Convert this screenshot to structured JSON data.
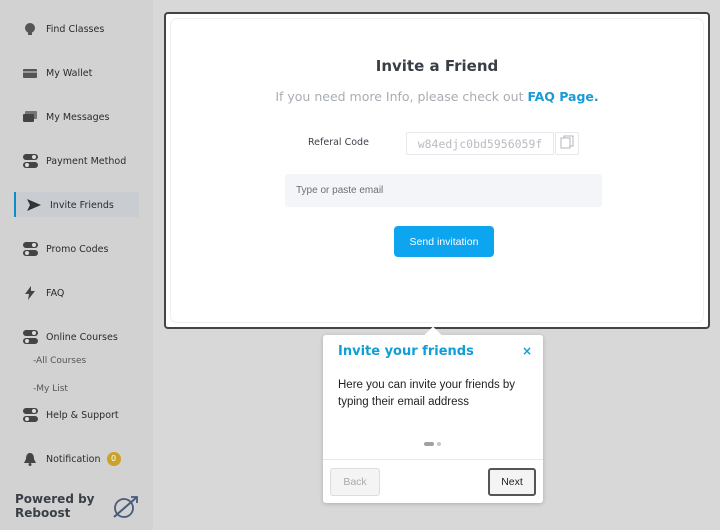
{
  "sidebar": {
    "items": [
      {
        "label": "Find Classes",
        "icon": "graduation-icon"
      },
      {
        "label": "My Wallet",
        "icon": "wallet-icon"
      },
      {
        "label": "My Messages",
        "icon": "messages-icon"
      },
      {
        "label": "Payment Method",
        "icon": "toggle-icon"
      },
      {
        "label": "Invite Friends",
        "icon": "send-icon"
      },
      {
        "label": "Promo Codes",
        "icon": "toggle-icon"
      },
      {
        "label": "FAQ",
        "icon": "bolt-icon"
      },
      {
        "label": "Online Courses",
        "icon": "toggle-icon"
      },
      {
        "label": "Help & Support",
        "icon": "toggle-icon"
      },
      {
        "label": "Notification",
        "icon": "bell-icon"
      }
    ],
    "sub_items": [
      "-All Courses",
      "-My List"
    ],
    "notification_count": "0",
    "powered_line1": "Powered by",
    "powered_line2": "Reboost",
    "accent_color": "#0b8ec5"
  },
  "modal": {
    "title": "Invite a Friend",
    "info_text": "If you need more Info, please check out",
    "faq_link": "FAQ Page.",
    "referral_label": "Referal Code",
    "referral_code": "w84edjc0bd5956059f",
    "email_placeholder": "Type or paste email",
    "send_label": "Send invitation",
    "button_color": "#0ea5f0"
  },
  "tour": {
    "title": "Invite your friends",
    "close": "×",
    "text": "Here you can invite your friends by typing their email address",
    "back_label": "Back",
    "next_label": "Next",
    "step": 1,
    "total_steps": 2
  }
}
